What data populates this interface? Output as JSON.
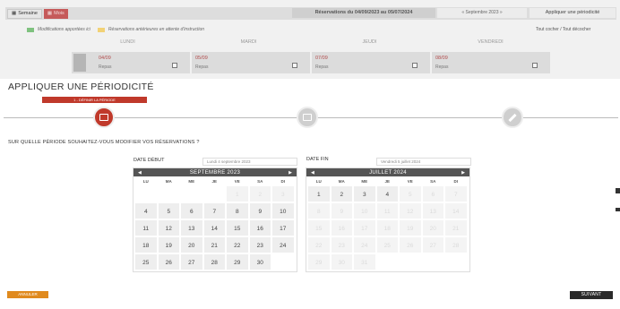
{
  "topbar": {
    "week_label": "Semaine",
    "month_label": "Mois",
    "range_label": "Réservations du 04/09/2023 au 05/07/2024",
    "month_nav": "« Septembre 2023 »",
    "apply_label": "Appliquer une périodicité"
  },
  "legend": {
    "item1": "Modifications apportées ici",
    "item2": "Réservations antérieures en attente d'instruction",
    "select_all": "Tout cocher / Tout décocher",
    "colors": {
      "item1": "#7fc27f",
      "item2": "#f2d276"
    }
  },
  "days": [
    "LUNDI",
    "MARDI",
    "JEUDI",
    "VENDREDI"
  ],
  "day_cells": [
    {
      "date": "04/09",
      "meal": "Repas"
    },
    {
      "date": "05/09",
      "meal": "Repas"
    },
    {
      "date": "07/09",
      "meal": "Repas"
    },
    {
      "date": "08/09",
      "meal": "Repas"
    }
  ],
  "modal": {
    "title": "APPLIQUER UNE PÉRIODICITÉ",
    "step_label": "1 - DÉFINIR LA PÉRIODE",
    "question": "SUR QUELLE PÉRIODE SOUHAITEZ-VOUS MODIFIER VOS RÉSERVATIONS ?",
    "start": {
      "label": "DATE DÉBUT",
      "value": "Lundi 4 septembre 2023",
      "month": "SEPTEMBRE 2023",
      "weekdays": [
        "LU",
        "MA",
        "ME",
        "JE",
        "VE",
        "SA",
        "DI"
      ],
      "rows": [
        [
          "",
          "",
          "",
          "",
          "1",
          "2",
          "3"
        ],
        [
          "4",
          "5",
          "6",
          "7",
          "8",
          "9",
          "10"
        ],
        [
          "11",
          "12",
          "13",
          "14",
          "15",
          "16",
          "17"
        ],
        [
          "18",
          "19",
          "20",
          "21",
          "22",
          "23",
          "24"
        ],
        [
          "25",
          "26",
          "27",
          "28",
          "29",
          "30",
          ""
        ]
      ]
    },
    "end": {
      "label": "DATE FIN",
      "value": "Vendredi 5 juillet 2024",
      "month": "JUILLET 2024",
      "weekdays": [
        "LU",
        "MA",
        "ME",
        "JE",
        "VE",
        "SA",
        "DI"
      ],
      "rows": [
        [
          "1",
          "2",
          "3",
          "4",
          "5",
          "6",
          "7"
        ],
        [
          "8",
          "9",
          "10",
          "11",
          "12",
          "13",
          "14"
        ],
        [
          "15",
          "16",
          "17",
          "18",
          "19",
          "20",
          "21"
        ],
        [
          "22",
          "23",
          "24",
          "25",
          "26",
          "27",
          "28"
        ],
        [
          "29",
          "30",
          "31",
          "",
          "",
          "",
          ""
        ]
      ]
    },
    "cancel_label": "ANNULER",
    "next_label": "SUIVANT"
  }
}
